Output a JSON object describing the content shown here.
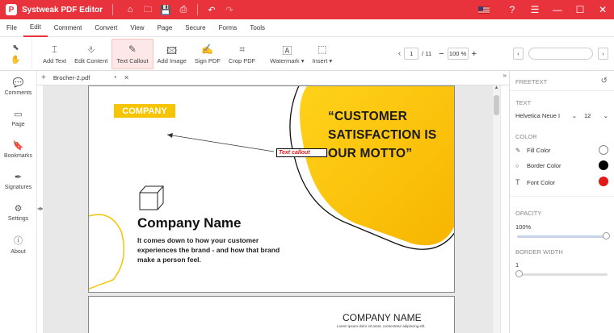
{
  "app": {
    "title": "Systweak PDF Editor",
    "logo": "P"
  },
  "menu": [
    "File",
    "Edit",
    "Comment",
    "Convert",
    "View",
    "Page",
    "Secure",
    "Forms",
    "Tools"
  ],
  "toolbar": {
    "tools": [
      {
        "label": "Add Text",
        "icon": "⌶"
      },
      {
        "label": "Edit Content",
        "icon": "⎀"
      },
      {
        "label": "Text Callout",
        "icon": "✎"
      },
      {
        "label": "Add Image",
        "icon": "🖾"
      },
      {
        "label": "Sign PDF",
        "icon": "✍"
      },
      {
        "label": "Crop PDF",
        "icon": "⌗"
      },
      {
        "label": "Watermark",
        "icon": "🄰"
      },
      {
        "label": "Insert",
        "icon": "⬚"
      }
    ],
    "page_current": "1",
    "page_total": "/ 11",
    "zoom": "100 %"
  },
  "sidebar": [
    {
      "label": "Comments",
      "icon": "💬"
    },
    {
      "label": "Page",
      "icon": "▭"
    },
    {
      "label": "Bookmarks",
      "icon": "🔖"
    },
    {
      "label": "Signatures",
      "icon": "✒"
    },
    {
      "label": "Settings",
      "icon": "⚙"
    },
    {
      "label": "About",
      "icon": "ⓘ"
    }
  ],
  "tab": {
    "name": "Brocher-2.pdf",
    "modified": "*"
  },
  "document": {
    "company_badge": "COMPANY",
    "headline": "“CUSTOMER SATISFACTION IS OUR MOTTO”",
    "callout": "Text callout",
    "company_name": "Company Name",
    "body": "It comes down to how your customer experiences the brand - and how that brand make a person feel.",
    "page2_title": "COMPANY NAME",
    "page2_sub": "Lorem ipsum dolor sit amet, consectetur adipiscing elit."
  },
  "panel": {
    "header": "FREETEXT",
    "text_label": "TEXT",
    "font": "Helvetica Neue I",
    "size": "12",
    "color_label": "COLOR",
    "fill": "Fill Color",
    "border": "Border Color",
    "fontcolor": "Font Color",
    "opacity_label": "OPACITY",
    "opacity": "100%",
    "border_width_label": "BORDER WIDTH",
    "border_width": "1",
    "colors": {
      "fill": "#ffffff",
      "border": "#000000",
      "font": "#e01818",
      "accent": "#e8333d"
    }
  }
}
